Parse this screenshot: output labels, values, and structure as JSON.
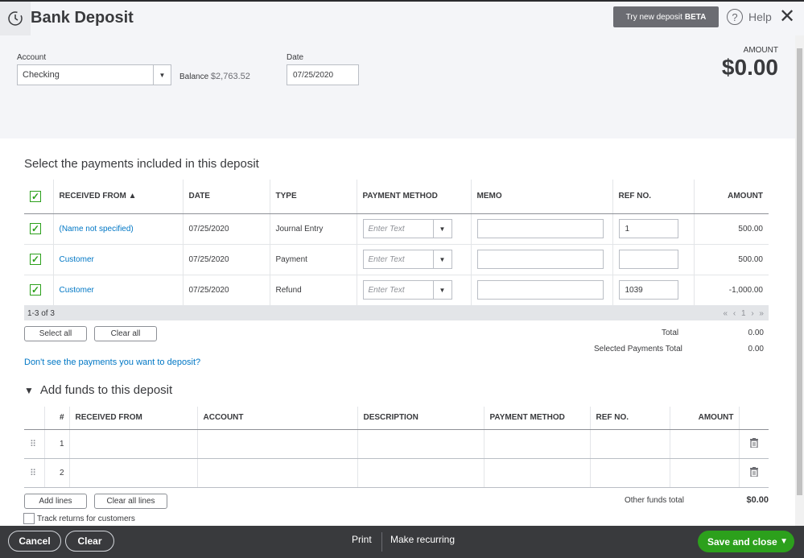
{
  "window": {
    "title": "Bank Deposit",
    "try_new_label": "Try new deposit",
    "try_new_badge": "BETA",
    "help_label": "Help"
  },
  "form": {
    "account_label": "Account",
    "account_value": "Checking",
    "balance_label": "Balance",
    "balance_value": "$2,763.52",
    "date_label": "Date",
    "date_value": "07/25/2020",
    "amount_label": "AMOUNT",
    "amount_value": "$0.00"
  },
  "payments": {
    "heading": "Select the payments included in this deposit",
    "columns": [
      "RECEIVED FROM ▲",
      "DATE",
      "TYPE",
      "PAYMENT METHOD",
      "MEMO",
      "REF NO.",
      "AMOUNT"
    ],
    "method_placeholder": "Enter Text",
    "rows": [
      {
        "received_from": "(Name not specified)",
        "date": "07/25/2020",
        "type": "Journal Entry",
        "memo": "",
        "ref": "1",
        "amount": "500.00"
      },
      {
        "received_from": "Customer",
        "date": "07/25/2020",
        "type": "Payment",
        "memo": "",
        "ref": "",
        "amount": "500.00"
      },
      {
        "received_from": "Customer",
        "date": "07/25/2020",
        "type": "Refund",
        "memo": "",
        "ref": "1039",
        "amount": "-1,000.00"
      }
    ],
    "range": "1-3 of 3",
    "pager": "« ‹ 1 › »",
    "select_all": "Select all",
    "clear_all": "Clear all",
    "total_label": "Total",
    "total_value": "0.00",
    "selected_label": "Selected Payments Total",
    "selected_value": "0.00",
    "dont_see": "Don't see the payments you want to deposit?"
  },
  "funds": {
    "heading": "Add funds to this deposit",
    "columns": [
      "#",
      "RECEIVED FROM",
      "ACCOUNT",
      "DESCRIPTION",
      "PAYMENT METHOD",
      "REF NO.",
      "AMOUNT"
    ],
    "rows": [
      {
        "num": "1"
      },
      {
        "num": "2"
      }
    ],
    "add_lines": "Add lines",
    "clear_all_lines": "Clear all lines",
    "other_total_label": "Other funds total",
    "other_total_value": "$0.00",
    "track_returns": "Track returns for customers"
  },
  "footer": {
    "cancel": "Cancel",
    "clear": "Clear",
    "print": "Print",
    "recurring": "Make recurring",
    "save": "Save and close"
  },
  "colors": {
    "accent_green": "#2ca01c",
    "link_blue": "#0077c5",
    "footer_bg": "#393a3d"
  }
}
